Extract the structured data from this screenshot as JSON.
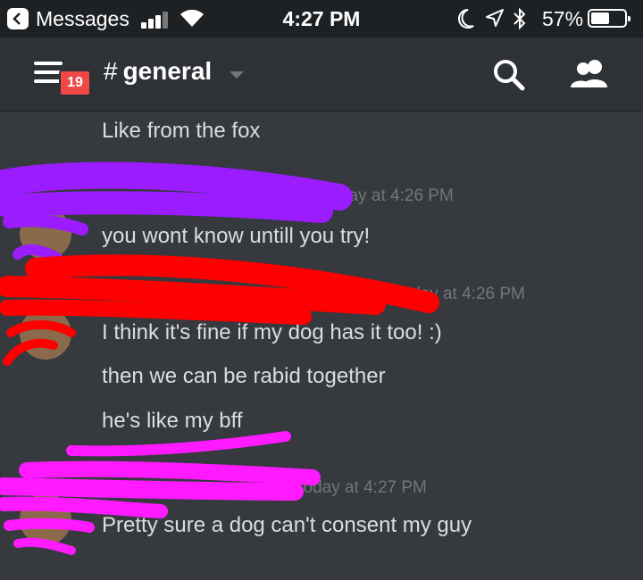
{
  "status_bar": {
    "back_app": "Messages",
    "time": "4:27 PM",
    "battery_percent": "57%",
    "battery_level": 0.57
  },
  "header": {
    "unread_count": "19",
    "channel_hash": "#",
    "channel_name": "general"
  },
  "messages": [
    {
      "lines": [
        "Like from the fox"
      ]
    },
    {
      "timestamp": "day at 4:26 PM",
      "lines": [
        "you wont know untill you try!"
      ]
    },
    {
      "timestamp": "Today at 4:26 PM",
      "lines": [
        "I think it's fine if my dog has it too! :)",
        "then we can be rabid together",
        "he's like my bff"
      ]
    },
    {
      "timestamp": "Today at 4:27 PM",
      "lines": [
        "Pretty sure a dog can't consent my guy"
      ]
    }
  ],
  "colors": {
    "background": "#36393e",
    "header": "#2e3136",
    "badge": "#f04747",
    "redaction_purple": "#9b1cff",
    "redaction_red": "#ff0000",
    "redaction_magenta": "#ff1aff"
  }
}
